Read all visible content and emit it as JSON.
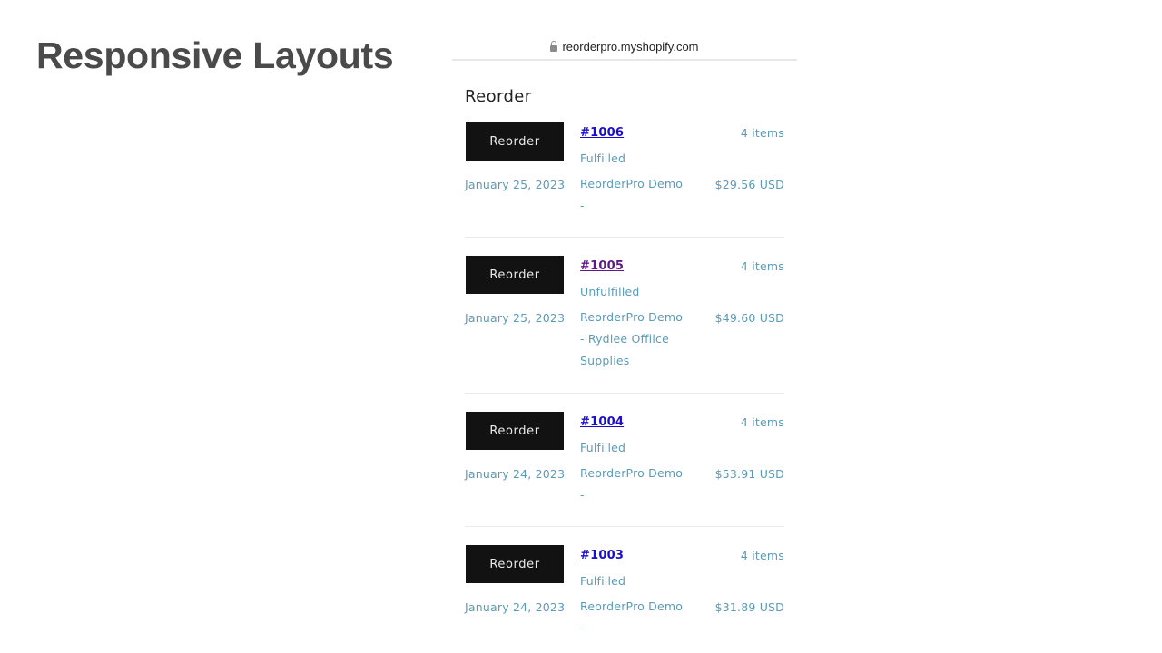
{
  "slide": {
    "title": "Responsive Layouts"
  },
  "browser": {
    "url": "reorderpro.myshopify.com",
    "lock_icon": "lock-icon"
  },
  "page": {
    "heading": "Reorder"
  },
  "orders": [
    {
      "button": "Reorder",
      "number": "#1006",
      "visited": false,
      "items": "4 items",
      "status": "Fulfilled",
      "date": "January 25, 2023",
      "customer": "ReorderPro Demo -",
      "total": "$29.56 USD"
    },
    {
      "button": "Reorder",
      "number": "#1005",
      "visited": true,
      "items": "4 items",
      "status": "Unfulfilled",
      "date": "January 25, 2023",
      "customer": "ReorderPro Demo - Rydlee Offiice Supplies",
      "total": "$49.60 USD"
    },
    {
      "button": "Reorder",
      "number": "#1004",
      "visited": false,
      "items": "4 items",
      "status": "Fulfilled",
      "date": "January 24, 2023",
      "customer": "ReorderPro Demo -",
      "total": "$53.91 USD"
    },
    {
      "button": "Reorder",
      "number": "#1003",
      "visited": false,
      "items": "4 items",
      "status": "Fulfilled",
      "date": "January 24, 2023",
      "customer": "ReorderPro Demo -",
      "total": "$31.89 USD"
    }
  ]
}
